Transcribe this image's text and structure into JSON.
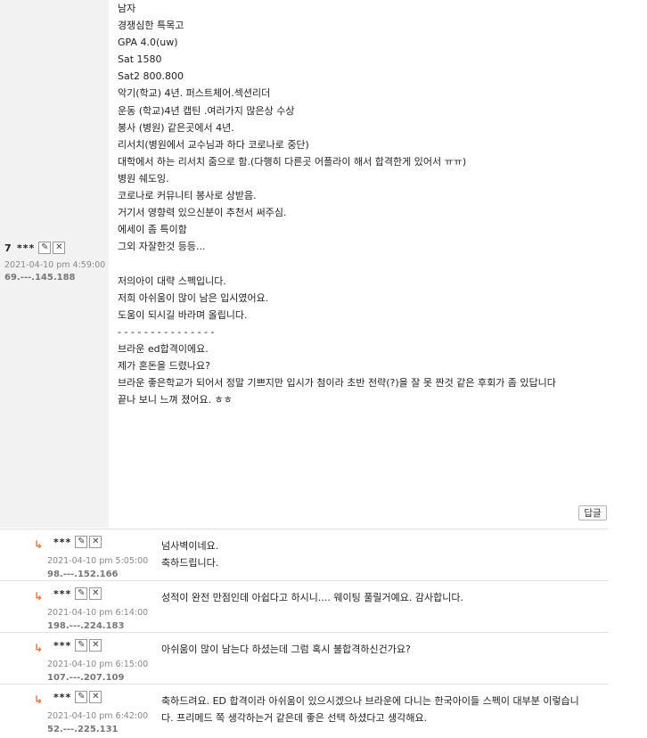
{
  "post": {
    "number": "7",
    "author": "***",
    "edit_icon": "edit-icon",
    "delete_icon": "close-icon",
    "date": "2021-04-10 pm 4:59:00",
    "ip": "69.---.145.188",
    "lines": [
      "남자",
      "경쟁심한 특목고",
      "GPA 4.0(uw)",
      "Sat 1580",
      "Sat2 800.800",
      "악기(학교) 4년. 퍼스트체어.섹션리더",
      "운동 (학교)4년 캡틴 .여러가지 많은상 수상",
      "봉사 (병원) 같은곳에서 4년.",
      "리서치(병원에서 교수님과 하다 코로나로 중단)",
      "대학에서 하는 리서치 줌으로 함.(다행히 다른곳 어플라이 해서 합격한게 있어서 ㅠㅠ)",
      "병원 쉐도잉.",
      "코로나로 커뮤니티 봉사로 상받음.",
      "거기서 영향력 있으신분이 추천서 써주심.",
      "에세이 좀 특이함",
      "그외 자잘한것 등등...",
      "",
      "저의아이 대략 스펙입니다.",
      "저희 아쉬움이 많이 남은 입시였어요.",
      "도움이 되시길 바라며 올립니다.",
      "- - - - - - - - - - - - - - -",
      "브라운 ed합격이에요.",
      "제가 혼돈을 드렸나요?",
      "브라운 좋은학교가 되어서 정말 기쁘지만 입시가 첨이라 초반 전략(?)을 잘 못 짠것 같은 후회가 좀 있답니다",
      "끝나 보니 느껴 졌어요. ㅎㅎ"
    ],
    "reply_label": "답글"
  },
  "comments": [
    {
      "author": "***",
      "date": "2021-04-10 pm 5:05:00",
      "ip": "98.---.152.166",
      "lines": [
        "넘사벽이네요.",
        "축하드립니다."
      ]
    },
    {
      "author": "***",
      "date": "2021-04-10 pm 6:14:00",
      "ip": "198.---.224.183",
      "lines": [
        "성적이 완전 만점인데 아쉽다고 하시니.... 웨이팅 풀릴거예요. 감사합니다."
      ]
    },
    {
      "author": "***",
      "date": "2021-04-10 pm 6:15:00",
      "ip": "107.---.207.109",
      "lines": [
        "아쉬움이 많이 남는다 하셨는데 그럼 혹시 불합격하신건가요?"
      ]
    },
    {
      "author": "***",
      "date": "2021-04-10 pm 6:42:00",
      "ip": "52.---.225.131",
      "lines": [
        "축하드려요. ED 합격이라 아쉬움이 있으시겠으나 브라운에 다니는 한국아이들 스펙이 대부분 이렇습니",
        "다. 프리메드 쪽 생각하는거 같은데 좋은 선택 하셨다고 생각해요."
      ]
    }
  ]
}
